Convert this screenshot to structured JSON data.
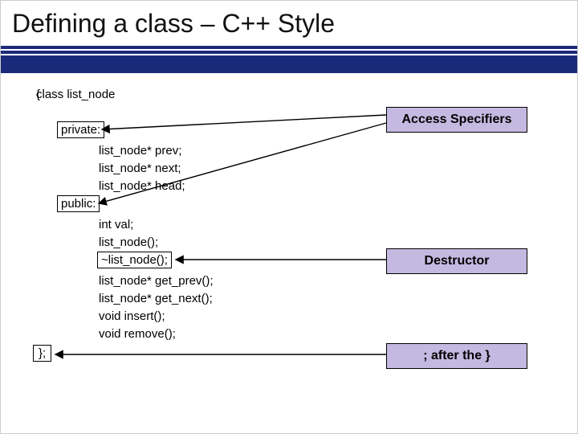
{
  "title": "Defining a class – C++ Style",
  "code": {
    "decl": "class list_node",
    "open": "{",
    "priv": "private:",
    "m1": "list_node* prev;",
    "m2": "list_node* next;",
    "m3": "list_node* head;",
    "pub": "public:",
    "p1": "int val;",
    "p2": "list_node();",
    "p3": "~list_node();",
    "p4": "list_node* get_prev();",
    "p5": "list_node* get_next();",
    "p6": "void insert();",
    "p7": "void remove();",
    "close": "};"
  },
  "callouts": {
    "access": "Access Specifiers",
    "destructor": "Destructor",
    "semi": "; after the }"
  }
}
